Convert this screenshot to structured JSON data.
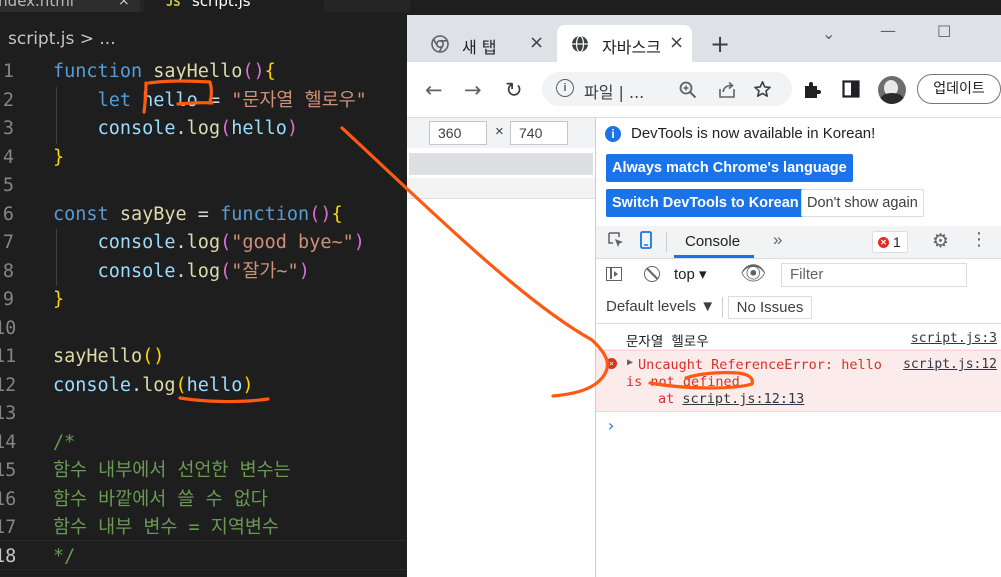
{
  "editor": {
    "tabs": [
      {
        "label": "index.html",
        "close": "×"
      },
      {
        "label": "script.js",
        "icon": "JS"
      }
    ],
    "breadcrumb": "script.js > ...",
    "lines": [
      {
        "n": "1",
        "tokens": [
          [
            "kw",
            "function "
          ],
          [
            "fn",
            "sayHello"
          ],
          [
            "paren",
            "()"
          ],
          [
            "brace",
            "{"
          ]
        ]
      },
      {
        "n": "2",
        "tokens": [
          [
            "pn",
            "    "
          ],
          [
            "kw",
            "let "
          ],
          [
            "var",
            "hello"
          ],
          [
            "pn",
            " = "
          ],
          [
            "str",
            "\"문자열 헬로우\""
          ]
        ]
      },
      {
        "n": "3",
        "tokens": [
          [
            "pn",
            "    "
          ],
          [
            "var",
            "console"
          ],
          [
            "pn",
            "."
          ],
          [
            "fn",
            "log"
          ],
          [
            "paren",
            "("
          ],
          [
            "var",
            "hello"
          ],
          [
            "paren",
            ")"
          ]
        ]
      },
      {
        "n": "4",
        "tokens": [
          [
            "brace",
            "}"
          ]
        ]
      },
      {
        "n": "5",
        "tokens": []
      },
      {
        "n": "6",
        "tokens": [
          [
            "kw",
            "const "
          ],
          [
            "fn",
            "sayBye"
          ],
          [
            "pn",
            " = "
          ],
          [
            "kw",
            "function"
          ],
          [
            "paren",
            "()"
          ],
          [
            "brace",
            "{"
          ]
        ]
      },
      {
        "n": "7",
        "tokens": [
          [
            "pn",
            "    "
          ],
          [
            "var",
            "console"
          ],
          [
            "pn",
            "."
          ],
          [
            "fn",
            "log"
          ],
          [
            "paren",
            "("
          ],
          [
            "str",
            "\"good bye~\""
          ],
          [
            "paren",
            ")"
          ]
        ]
      },
      {
        "n": "8",
        "tokens": [
          [
            "pn",
            "    "
          ],
          [
            "var",
            "console"
          ],
          [
            "pn",
            "."
          ],
          [
            "fn",
            "log"
          ],
          [
            "paren",
            "("
          ],
          [
            "str",
            "\"잘가~\""
          ],
          [
            "paren",
            ")"
          ]
        ]
      },
      {
        "n": "9",
        "tokens": [
          [
            "brace",
            "}"
          ]
        ]
      },
      {
        "n": "10",
        "tokens": []
      },
      {
        "n": "11",
        "tokens": [
          [
            "fn",
            "sayHello"
          ],
          [
            "brace",
            "()"
          ]
        ]
      },
      {
        "n": "12",
        "tokens": [
          [
            "var",
            "console"
          ],
          [
            "pn",
            "."
          ],
          [
            "fn",
            "log"
          ],
          [
            "brace",
            "("
          ],
          [
            "var",
            "hello"
          ],
          [
            "brace",
            ")"
          ]
        ]
      },
      {
        "n": "13",
        "tokens": []
      },
      {
        "n": "14",
        "tokens": [
          [
            "cm",
            "/*"
          ]
        ]
      },
      {
        "n": "15",
        "tokens": [
          [
            "cm",
            "함수 내부에서 선언한 변수는"
          ]
        ]
      },
      {
        "n": "16",
        "tokens": [
          [
            "cm",
            "함수 바깥에서 쓸 수 없다"
          ]
        ]
      },
      {
        "n": "17",
        "tokens": [
          [
            "cm",
            "함수 내부 변수 = 지역변수"
          ]
        ]
      },
      {
        "n": "18",
        "tokens": [
          [
            "cm",
            "*/"
          ]
        ],
        "active": true
      }
    ]
  },
  "chrome": {
    "tabs": [
      {
        "title": "새 탭",
        "close": "×",
        "icon": "chrome-icon"
      },
      {
        "title": "자바스크",
        "close": "×",
        "icon": "globe-icon"
      }
    ],
    "new_tab": "+",
    "window_buttons": {
      "menu": "⌄",
      "minimize": "—",
      "maximize": "☐"
    },
    "nav": {
      "back": "←",
      "forward": "→",
      "reload": "↻"
    },
    "omnibox": {
      "info": "i",
      "url": "파일 | ..."
    },
    "update_label": "업데이트",
    "device": {
      "width": "360",
      "x": "×",
      "height": "740"
    }
  },
  "devtools": {
    "info_message": "DevTools is now available in Korean!",
    "info_icon": "i",
    "buttons": {
      "match": "Always match Chrome's language",
      "switch": "Switch DevTools to Korean",
      "dont_show": "Don't show again"
    },
    "tabs": {
      "console": "Console",
      "more": "»"
    },
    "error_count": "1",
    "toolbar": {
      "context": "top ▾",
      "filter_placeholder": "Filter",
      "levels": "Default levels ▼",
      "issues": "No Issues"
    },
    "messages": {
      "log_text": "문자열 헬로우",
      "log_source": "script.js:3",
      "error_line1": "Uncaught ReferenceError: hello",
      "error_source": "script.js:12",
      "error_line2": "is not defined",
      "error_line3_prefix": "at ",
      "error_location": "script.js:12:13",
      "prompt": "›"
    }
  },
  "colors": {
    "editor_bg": "#1e1e1e",
    "annotation": "#ff5a12",
    "devtools_blue": "#1a73e8",
    "error_red": "#d93025"
  }
}
